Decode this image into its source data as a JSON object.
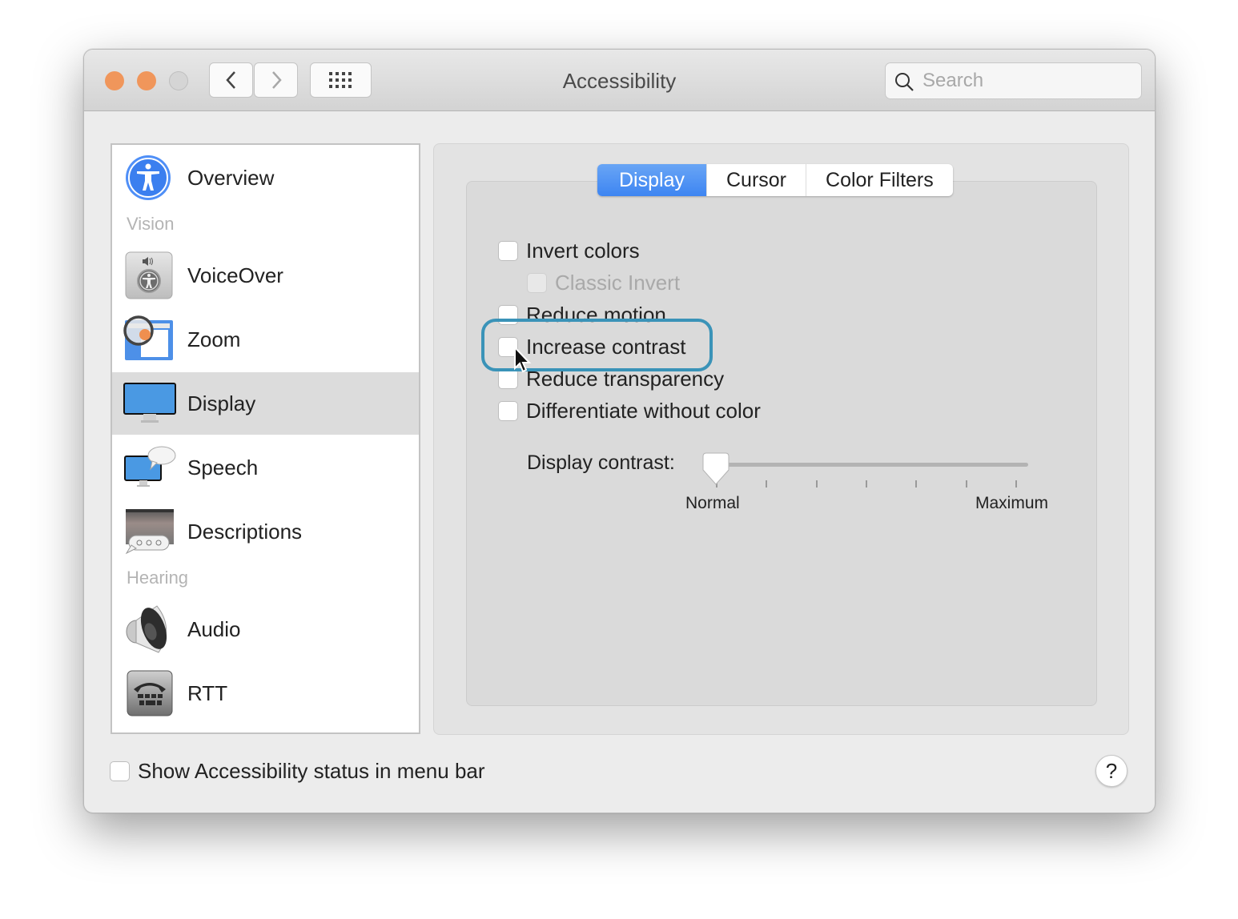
{
  "window": {
    "title": "Accessibility",
    "traffic_lights": {
      "close": "#f0965b",
      "minimize": "#f0965b",
      "zoom": "#d5d5d5"
    },
    "toolbar": {
      "back_icon": "chevron-left-icon",
      "forward_icon": "chevron-right-icon",
      "show_all_icon": "grid-icon"
    },
    "search": {
      "placeholder": "Search",
      "value": ""
    }
  },
  "sidebar": {
    "sections": [
      {
        "label": null,
        "items": [
          {
            "label": "Overview",
            "icon": "accessibility-icon"
          }
        ]
      },
      {
        "label": "Vision",
        "items": [
          {
            "label": "VoiceOver",
            "icon": "voiceover-icon"
          },
          {
            "label": "Zoom",
            "icon": "magnifier-icon"
          },
          {
            "label": "Display",
            "icon": "monitor-icon",
            "selected": true
          },
          {
            "label": "Speech",
            "icon": "speech-bubble-monitor-icon"
          },
          {
            "label": "Descriptions",
            "icon": "descriptions-icon"
          }
        ]
      },
      {
        "label": "Hearing",
        "items": [
          {
            "label": "Audio",
            "icon": "speaker-icon"
          },
          {
            "label": "RTT",
            "icon": "tty-phone-icon"
          }
        ]
      }
    ]
  },
  "tabs": [
    {
      "label": "Display",
      "active": true
    },
    {
      "label": "Cursor",
      "active": false
    },
    {
      "label": "Color Filters",
      "active": false
    }
  ],
  "display_options": [
    {
      "label": "Invert colors",
      "checked": false,
      "enabled": true
    },
    {
      "label": "Classic Invert",
      "checked": false,
      "enabled": false
    },
    {
      "label": "Reduce motion",
      "checked": false,
      "enabled": true
    },
    {
      "label": "Increase contrast",
      "checked": false,
      "enabled": true,
      "highlighted": true
    },
    {
      "label": "Reduce transparency",
      "checked": false,
      "enabled": true
    },
    {
      "label": "Differentiate without color",
      "checked": false,
      "enabled": true
    }
  ],
  "contrast_slider": {
    "label": "Display contrast:",
    "min_label": "Normal",
    "max_label": "Maximum",
    "value": 0,
    "tick_count": 7
  },
  "footer": {
    "show_status_label": "Show Accessibility status in menu bar",
    "show_status_checked": false,
    "help_label": "?"
  },
  "colors": {
    "accent": "#3d85f2",
    "highlight_ring": "#3a93b8"
  }
}
